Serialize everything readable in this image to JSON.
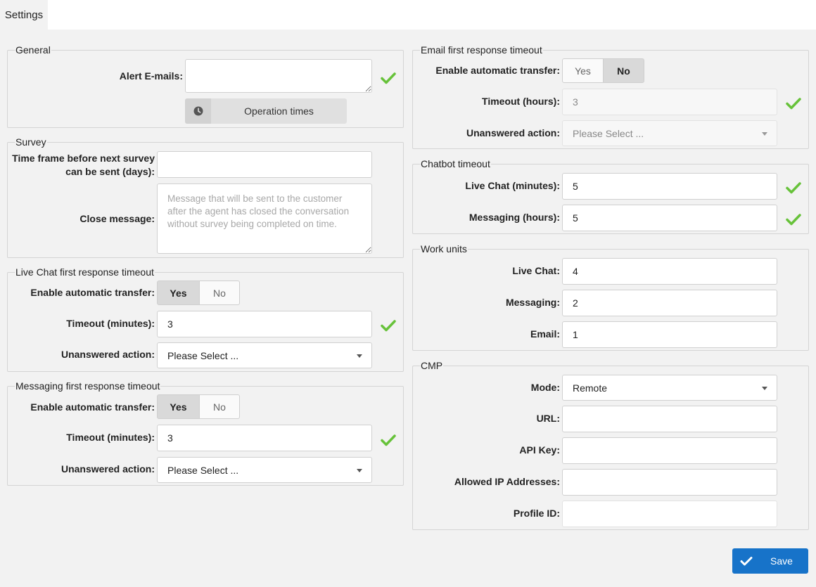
{
  "tabs": {
    "settings": "Settings"
  },
  "colors": {
    "accent": "#1773c9",
    "valid_check": "#67c23a",
    "background": "#f2f2f2"
  },
  "icons": {
    "valid": "check-icon",
    "clock": "clock-icon",
    "save": "check-icon"
  },
  "general": {
    "legend": "General",
    "alert_emails_label": "Alert E-mails:",
    "alert_emails_value": "",
    "operation_times_label": "Operation times"
  },
  "survey": {
    "legend": "Survey",
    "time_frame_label_line1": "Time frame before next survey",
    "time_frame_label_line2": "can be sent (days):",
    "time_frame_value": "",
    "close_message_label": "Close message:",
    "close_message_placeholder": "Message that will be sent to the customer after the agent has closed the conversation without survey being completed on time."
  },
  "live_chat_timeout": {
    "legend": "Live Chat first response timeout",
    "enable_label": "Enable automatic transfer:",
    "yes": "Yes",
    "no": "No",
    "selected": "Yes",
    "timeout_label": "Timeout (minutes):",
    "timeout_value": "3",
    "unanswered_label": "Unanswered action:",
    "unanswered_value": "Please Select ..."
  },
  "messaging_timeout": {
    "legend": "Messaging first response timeout",
    "enable_label": "Enable automatic transfer:",
    "yes": "Yes",
    "no": "No",
    "selected": "Yes",
    "timeout_label": "Timeout (minutes):",
    "timeout_value": "3",
    "unanswered_label": "Unanswered action:",
    "unanswered_value": "Please Select ..."
  },
  "email_timeout": {
    "legend": "Email first response timeout",
    "enable_label": "Enable automatic transfer:",
    "yes": "Yes",
    "no": "No",
    "selected": "No",
    "timeout_label": "Timeout (hours):",
    "timeout_value": "3",
    "unanswered_label": "Unanswered action:",
    "unanswered_value": "Please Select ..."
  },
  "chatbot_timeout": {
    "legend": "Chatbot timeout",
    "live_chat_label": "Live Chat (minutes):",
    "live_chat_value": "5",
    "messaging_label": "Messaging (hours):",
    "messaging_value": "5"
  },
  "work_units": {
    "legend": "Work units",
    "live_chat_label": "Live Chat:",
    "live_chat_value": "4",
    "messaging_label": "Messaging:",
    "messaging_value": "2",
    "email_label": "Email:",
    "email_value": "1"
  },
  "cmp": {
    "legend": "CMP",
    "mode_label": "Mode:",
    "mode_value": "Remote",
    "url_label": "URL:",
    "url_value": "",
    "api_key_label": "API Key:",
    "api_key_value": "",
    "allowed_ip_label": "Allowed IP Addresses:",
    "allowed_ip_value": "",
    "profile_id_label": "Profile ID:",
    "profile_id_value": ""
  },
  "save_label": "Save"
}
